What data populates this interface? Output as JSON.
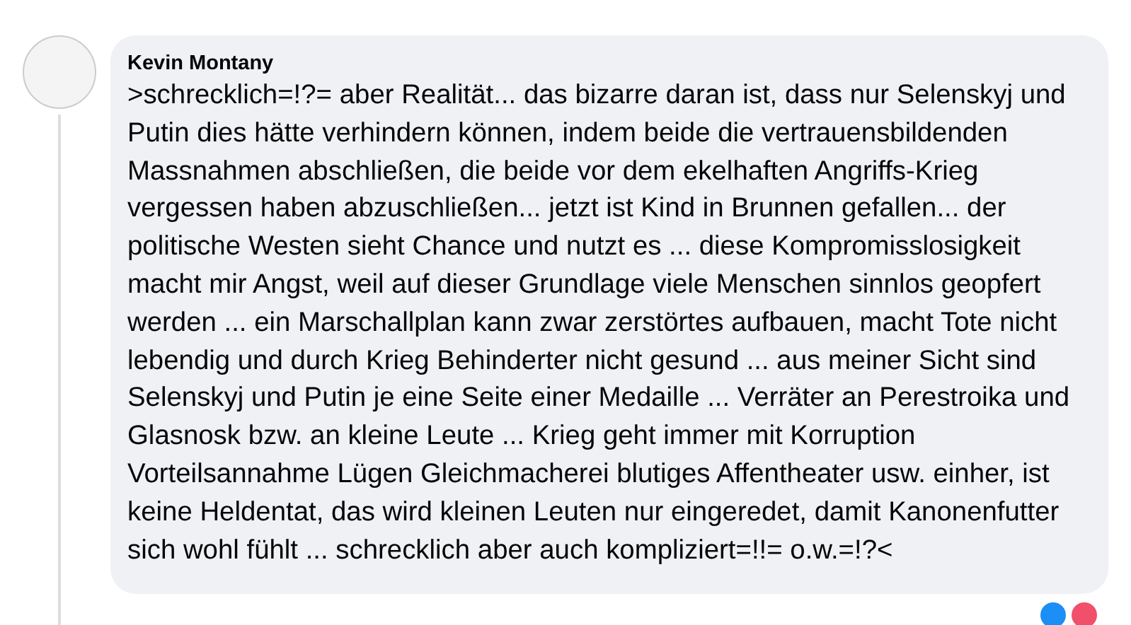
{
  "comment": {
    "author": "Kevin Montany",
    "text": ">schrecklich=!?= aber Realität... das bizarre daran ist, dass nur Selenskyj und Putin dies hätte verhindern können, indem beide die vertrauensbildenden Massnahmen abschließen, die beide vor dem ekelhaften Angriffs-Krieg vergessen haben abzuschließen... jetzt ist Kind in Brunnen gefallen... der politische Westen sieht Chance und nutzt es ... diese Kompromisslosigkeit macht mir Angst, weil auf dieser Grundlage viele Menschen sinnlos geopfert werden ... ein Marschallplan kann zwar zerstörtes aufbauen, macht Tote nicht lebendig und durch Krieg Behinderter nicht gesund ... aus meiner Sicht sind Selenskyj und Putin je eine Seite einer Medaille ... Verräter an Perestroika und Glasnosk bzw. an kleine Leute ... Krieg geht immer mit Korruption Vorteilsannahme Lügen Gleichmacherei blutiges Affentheater usw. einher, ist keine Heldentat, das wird kleinen Leuten nur eingeredet, damit Kanonenfutter sich wohl fühlt ... schrecklich aber auch kompliziert=!!= o.w.=!?<"
  }
}
